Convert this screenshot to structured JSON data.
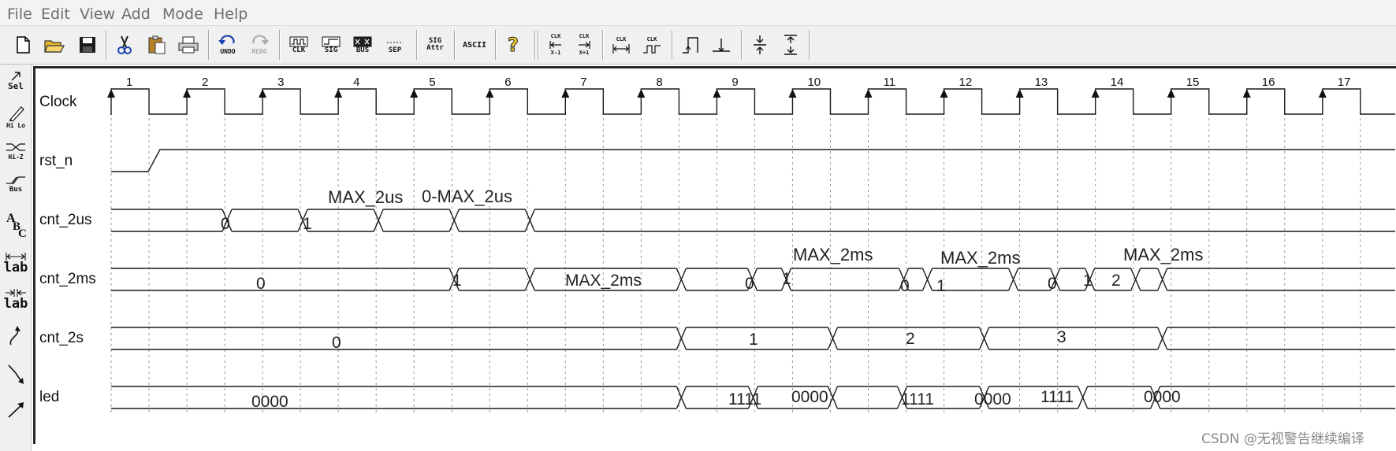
{
  "menu": [
    "File",
    "Edit",
    "View",
    "Add",
    "Mode",
    "Help"
  ],
  "toolbar": {
    "undo": "UNDO",
    "redo": "REDO",
    "clk": "CLK",
    "sig": "SIG",
    "bus": "BUS",
    "sep": "SEP",
    "sig_attr": [
      "SIG",
      "Attr"
    ],
    "ascii": "ASCII",
    "clk_label": "CLK",
    "clk_minus": "X-1",
    "clk_plus": "X+1"
  },
  "left_tools": {
    "sel": "Sel",
    "hilo": "Hi Lo",
    "hiz": "Hi-Z",
    "bus": "Bus",
    "lab1": "lab",
    "lab2": "lab"
  },
  "clock_cycles": [
    "1",
    "2",
    "3",
    "4",
    "5",
    "6",
    "7",
    "8",
    "9",
    "10",
    "11",
    "12",
    "13",
    "14",
    "15",
    "16",
    "17"
  ],
  "signals": [
    {
      "name": "Clock",
      "type": "clock"
    },
    {
      "name": "rst_n",
      "type": "bit"
    },
    {
      "name": "cnt_2us",
      "type": "bus",
      "values": [
        "0",
        "1"
      ],
      "annotations": [
        "MAX_2us",
        "0-MAX_2us"
      ]
    },
    {
      "name": "cnt_2ms",
      "type": "bus",
      "values": [
        "0",
        "1",
        "MAX_2ms",
        "0",
        "1",
        "0",
        "1",
        "0",
        "1",
        "2"
      ],
      "annotations": [
        "MAX_2ms",
        "MAX_2ms",
        "MAX_2ms"
      ]
    },
    {
      "name": "cnt_2s",
      "type": "bus",
      "values": [
        "0",
        "1",
        "2",
        "3"
      ]
    },
    {
      "name": "led",
      "type": "bus",
      "values": [
        "0000",
        "1111",
        "0000",
        "1111",
        "0000",
        "1111",
        "0000"
      ]
    }
  ],
  "watermark": "CSDN @无视警告继续编译"
}
